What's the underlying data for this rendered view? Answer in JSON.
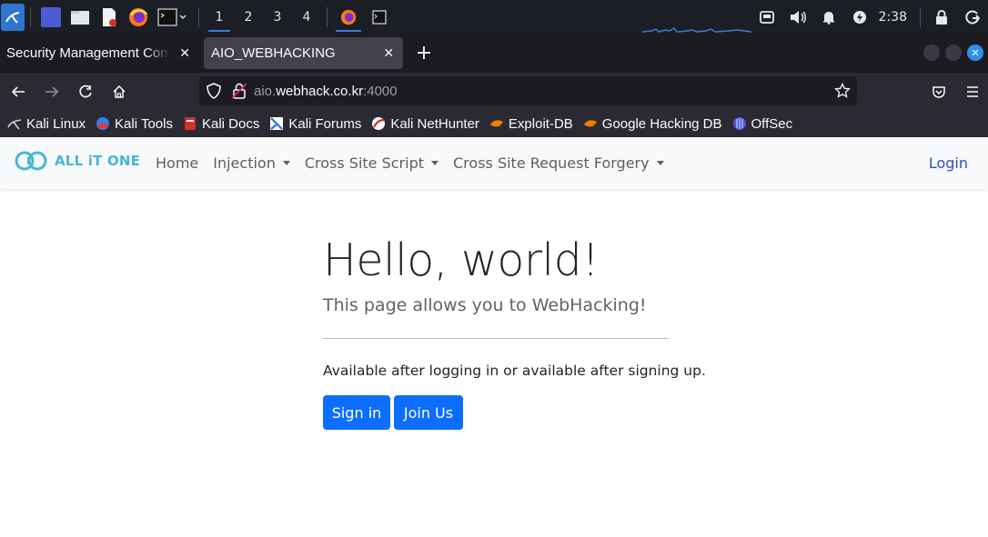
{
  "taskbar": {
    "workspaces": [
      "1",
      "2",
      "3",
      "4"
    ],
    "clock": "2:38",
    "icons": [
      "kali-menu-icon",
      "desktop-icon",
      "file-manager-icon",
      "text-editor-icon",
      "firefox-icon",
      "terminal-icon"
    ]
  },
  "tabs": [
    {
      "label": "Security Management Console",
      "active": false
    },
    {
      "label": "AIO_WEBHACKING",
      "active": true
    }
  ],
  "urlbar": {
    "prefix": "aio.",
    "domain": "webhack.co.kr",
    "suffix": ":4000"
  },
  "bookmarks": [
    {
      "label": "Kali Linux"
    },
    {
      "label": "Kali Tools"
    },
    {
      "label": "Kali Docs"
    },
    {
      "label": "Kali Forums"
    },
    {
      "label": "Kali NetHunter"
    },
    {
      "label": "Exploit-DB"
    },
    {
      "label": "Google Hacking DB"
    },
    {
      "label": "OffSec"
    }
  ],
  "site": {
    "brand": "ALL iT ONE",
    "nav": {
      "home": "Home",
      "injection": "Injection",
      "xss": "Cross Site Script",
      "csrf": "Cross Site Request Forgery",
      "login": "Login"
    },
    "hero": {
      "title": "Hello, world!",
      "lead": "This page allows you to WebHacking!",
      "info": "Available after logging in or available after signing up.",
      "signin": "Sign in",
      "join": "Join Us"
    }
  },
  "colors": {
    "primary": "#0d6efd",
    "brand": "#4ab6d3",
    "taskbar": "#1b1e24"
  }
}
